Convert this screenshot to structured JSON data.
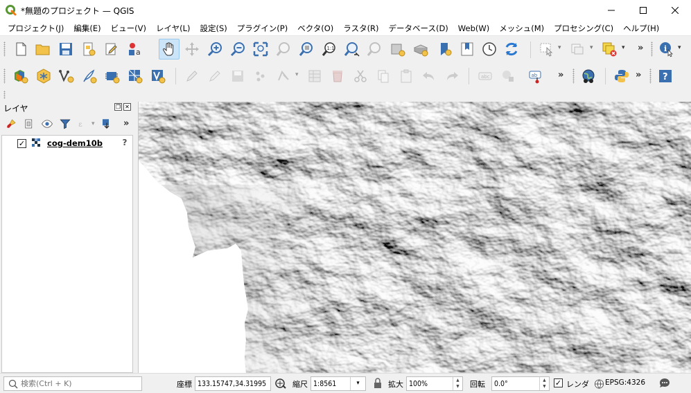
{
  "window": {
    "title": "*無題のプロジェクト — QGIS",
    "app_icon": "qgis-logo-icon",
    "controls": [
      "minimize-icon",
      "maximize-icon",
      "close-icon"
    ]
  },
  "menu": [
    {
      "label": "プロジェクト(J)"
    },
    {
      "label": "編集(E)"
    },
    {
      "label": "ビュー(V)"
    },
    {
      "label": "レイヤ(L)"
    },
    {
      "label": "設定(S)"
    },
    {
      "label": "プラグイン(P)"
    },
    {
      "label": "ベクタ(O)"
    },
    {
      "label": "ラスタ(R)"
    },
    {
      "label": "データベース(D)"
    },
    {
      "label": "Web(W)"
    },
    {
      "label": "メッシュ(M)"
    },
    {
      "label": "プロセシング(C)"
    },
    {
      "label": "ヘルプ(H)"
    }
  ],
  "toolbar_overflow": "»",
  "layers_panel": {
    "title": "レイヤ",
    "layers": [
      {
        "name": "cog-dem10b",
        "checked": true,
        "icon": "raster-layer-icon"
      }
    ]
  },
  "colors": {
    "accent": "#0078d7",
    "selected_tool": "#cce4f7",
    "qgis_green": "#589632",
    "qgis_yellow": "#ee7913"
  },
  "status": {
    "search_placeholder": "検索(Ctrl + K)",
    "coordinate_label": "座標",
    "coordinate": "133.15747,34.31995",
    "scale_label": "縮尺",
    "scale": "1:8561",
    "magnifier_label": "拡大",
    "magnifier": "100%",
    "rotation_label": "回転",
    "rotation": "0.0°",
    "render_label": "レンダ",
    "render_checked": true,
    "crs": "EPSG:4326"
  }
}
